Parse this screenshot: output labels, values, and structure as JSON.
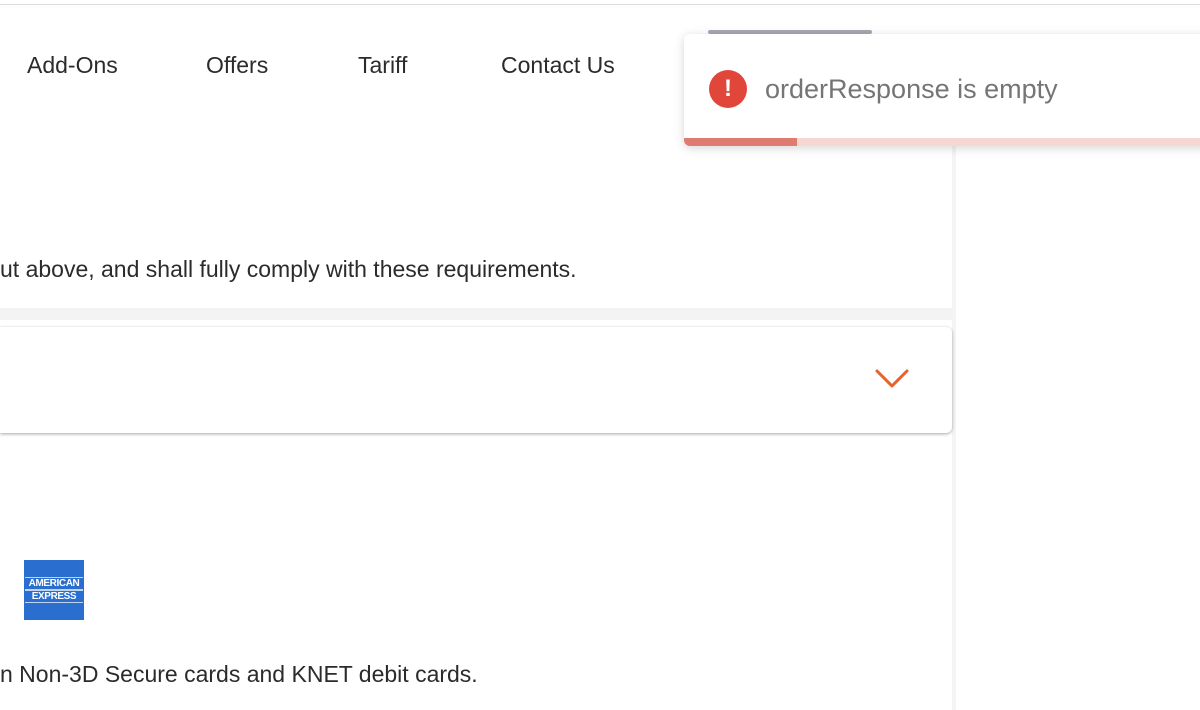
{
  "nav": {
    "items": [
      {
        "label": "Add-Ons"
      },
      {
        "label": "Offers"
      },
      {
        "label": "Tariff"
      },
      {
        "label": "Contact Us"
      }
    ]
  },
  "main": {
    "terms_text": "ut above, and shall fully comply with these requirements.",
    "cards_text": "n Non-3D Secure cards and KNET debit cards.",
    "accordion": {
      "icon": "chevron-down-icon",
      "accent_color": "#e8622a"
    },
    "amex_logo": {
      "line1": "AMERICAN",
      "line2": "EXPRESS",
      "color": "#2a6fcf"
    }
  },
  "toast": {
    "message": "orderResponse is empty",
    "icon": "error-icon",
    "icon_glyph": "!",
    "icon_color": "#e1463b",
    "progress": 0.21
  }
}
